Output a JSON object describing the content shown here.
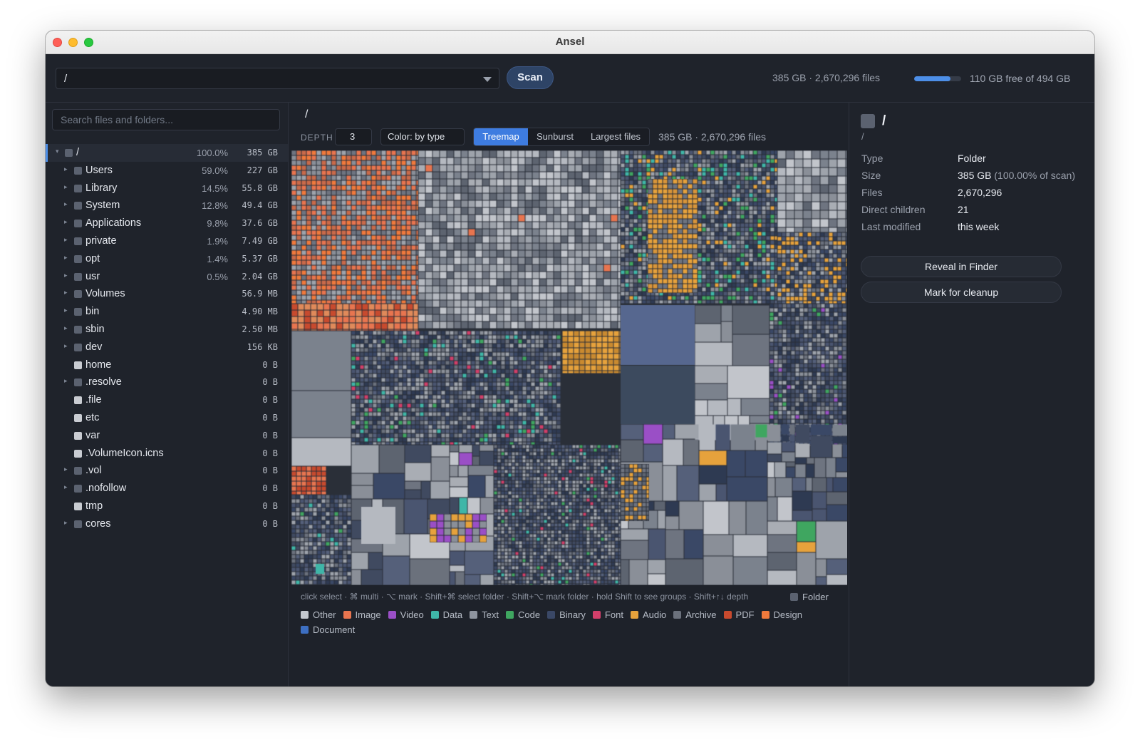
{
  "window": {
    "title": "Ansel"
  },
  "toolbar": {
    "path_value": "/",
    "scan_label": "Scan",
    "scan_stats": "385 GB · 2,670,296 files",
    "disk_used_fraction": 0.78,
    "disk_free_label": "110 GB free of 494 GB"
  },
  "sidebar": {
    "search_placeholder": "Search files and folders...",
    "items": [
      {
        "name": "/",
        "pct": "100.0%",
        "size": "385 GB",
        "expandable": true,
        "kind": "folder",
        "root": true
      },
      {
        "name": "Users",
        "pct": "59.0%",
        "size": "227 GB",
        "expandable": true,
        "kind": "folder"
      },
      {
        "name": "Library",
        "pct": "14.5%",
        "size": "55.8 GB",
        "expandable": true,
        "kind": "folder"
      },
      {
        "name": "System",
        "pct": "12.8%",
        "size": "49.4 GB",
        "expandable": true,
        "kind": "folder"
      },
      {
        "name": "Applications",
        "pct": "9.8%",
        "size": "37.6 GB",
        "expandable": true,
        "kind": "folder"
      },
      {
        "name": "private",
        "pct": "1.9%",
        "size": "7.49 GB",
        "expandable": true,
        "kind": "folder"
      },
      {
        "name": "opt",
        "pct": "1.4%",
        "size": "5.37 GB",
        "expandable": true,
        "kind": "folder"
      },
      {
        "name": "usr",
        "pct": "0.5%",
        "size": "2.04 GB",
        "expandable": true,
        "kind": "folder"
      },
      {
        "name": "Volumes",
        "pct": "",
        "size": "56.9 MB",
        "expandable": true,
        "kind": "folder"
      },
      {
        "name": "bin",
        "pct": "",
        "size": "4.90 MB",
        "expandable": true,
        "kind": "folder"
      },
      {
        "name": "sbin",
        "pct": "",
        "size": "2.50 MB",
        "expandable": true,
        "kind": "folder"
      },
      {
        "name": "dev",
        "pct": "",
        "size": "156 KB",
        "expandable": true,
        "kind": "folder"
      },
      {
        "name": "home",
        "pct": "",
        "size": "0 B",
        "expandable": false,
        "kind": "file"
      },
      {
        "name": ".resolve",
        "pct": "",
        "size": "0 B",
        "expandable": true,
        "kind": "folder"
      },
      {
        "name": ".file",
        "pct": "",
        "size": "0 B",
        "expandable": false,
        "kind": "file"
      },
      {
        "name": "etc",
        "pct": "",
        "size": "0 B",
        "expandable": false,
        "kind": "file"
      },
      {
        "name": "var",
        "pct": "",
        "size": "0 B",
        "expandable": false,
        "kind": "file"
      },
      {
        "name": ".VolumeIcon.icns",
        "pct": "",
        "size": "0 B",
        "expandable": false,
        "kind": "file"
      },
      {
        "name": ".vol",
        "pct": "",
        "size": "0 B",
        "expandable": true,
        "kind": "folder"
      },
      {
        "name": ".nofollow",
        "pct": "",
        "size": "0 B",
        "expandable": true,
        "kind": "folder"
      },
      {
        "name": "tmp",
        "pct": "",
        "size": "0 B",
        "expandable": false,
        "kind": "file"
      },
      {
        "name": "cores",
        "pct": "",
        "size": "0 B",
        "expandable": true,
        "kind": "folder"
      }
    ]
  },
  "main": {
    "breadcrumb": "/",
    "depth_label": "DEPTH",
    "depth_value": "3",
    "color_mode": "Color: by type",
    "tabs": [
      {
        "label": "Treemap",
        "active": true
      },
      {
        "label": "Sunburst",
        "active": false
      },
      {
        "label": "Largest files",
        "active": false
      }
    ],
    "stats": "385 GB · 2,670,296 files",
    "hint": "click select · ⌘ multi · ⌥ mark · Shift+⌘ select folder · Shift+⌥ mark folder · hold Shift to see groups · Shift+↑↓ depth",
    "folder_legend": "Folder",
    "legend": [
      {
        "label": "Other",
        "color": "#c4c8cf"
      },
      {
        "label": "Image",
        "color": "#e8754f"
      },
      {
        "label": "Video",
        "color": "#9a4fc6"
      },
      {
        "label": "Data",
        "color": "#3fb6a8"
      },
      {
        "label": "Text",
        "color": "#8f959f"
      },
      {
        "label": "Code",
        "color": "#3fa660"
      },
      {
        "label": "Binary",
        "color": "#3a4866"
      },
      {
        "label": "Font",
        "color": "#d23f6a"
      },
      {
        "label": "Audio",
        "color": "#e6a23c"
      },
      {
        "label": "Archive",
        "color": "#6b717c"
      },
      {
        "label": "PDF",
        "color": "#c84a2e"
      },
      {
        "label": "Design",
        "color": "#f07a3c"
      },
      {
        "label": "Document",
        "color": "#3d6fc2"
      }
    ]
  },
  "details": {
    "name": "/",
    "path": "/",
    "rows": [
      {
        "key": "Type",
        "value": "Folder",
        "extra": ""
      },
      {
        "key": "Size",
        "value": "385 GB",
        "extra": "(100.00% of scan)"
      },
      {
        "key": "Files",
        "value": "2,670,296",
        "extra": ""
      },
      {
        "key": "Direct children",
        "value": "21",
        "extra": ""
      },
      {
        "key": "Last modified",
        "value": "this week",
        "extra": ""
      }
    ],
    "reveal_label": "Reveal in Finder",
    "cleanup_label": "Mark for cleanup"
  }
}
